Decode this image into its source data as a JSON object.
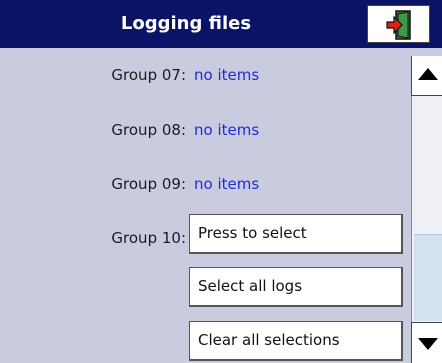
{
  "header": {
    "title": "Logging files",
    "exit_icon": "exit-door-icon"
  },
  "groups": [
    {
      "label": "Group 07:",
      "value": "no items"
    },
    {
      "label": "Group 08:",
      "value": "no items"
    },
    {
      "label": "Group 09:",
      "value": "no items"
    },
    {
      "label": "Group 10:",
      "button": "Press to select"
    }
  ],
  "actions": {
    "select_all": "Select all logs",
    "clear_all": "Clear all selections"
  },
  "scrollbar": {
    "up_icon": "triangle-up-icon",
    "down_icon": "triangle-down-icon"
  },
  "colors": {
    "header_bg": "#0a1466",
    "page_bg": "#c9ccdf",
    "value_text": "#1f2bd6",
    "exit_icon_red": "#e0201c",
    "exit_icon_green": "#2e7d32"
  }
}
